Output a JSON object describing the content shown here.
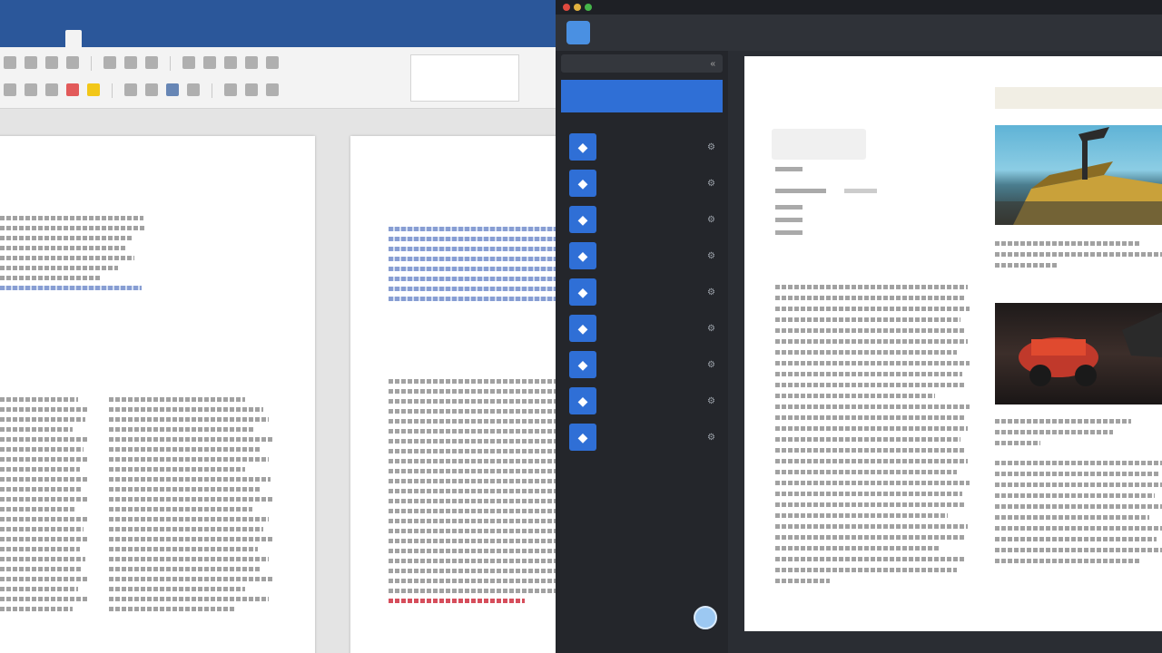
{
  "word": {
    "title_text": "",
    "tabs": [
      "",
      "",
      "",
      "",
      "",
      "",
      "",
      "",
      "",
      "",
      "",
      ""
    ],
    "active_tab_index": 4,
    "doc": {
      "page1_heading": "",
      "page2_heading1": "",
      "page2_heading2": ""
    }
  },
  "reader_app": {
    "logo_text": "",
    "nav": [
      "",
      "",
      "",
      "",
      "",
      "",
      ""
    ],
    "sidebar": {
      "search_placeholder": "",
      "selected_item": "",
      "section_label": "",
      "section_count": "",
      "items": [
        {
          "label": "",
          "icon": "document-icon"
        },
        {
          "label": "",
          "icon": "document-icon"
        },
        {
          "label": "",
          "icon": "document-icon"
        },
        {
          "label": "",
          "icon": "document-icon"
        },
        {
          "label": "",
          "icon": "document-icon"
        },
        {
          "label": "",
          "icon": "document-icon"
        },
        {
          "label": "",
          "icon": "document-icon"
        },
        {
          "label": "",
          "icon": "document-icon"
        },
        {
          "label": "",
          "icon": "document-icon"
        }
      ]
    },
    "article": {
      "title": "",
      "card_text": "",
      "section_heading": "",
      "aside_heading": ""
    },
    "colors": {
      "word_brand": "#2b579a",
      "accent_blue": "#2f6fd6",
      "app_dark": "#2a2d33"
    }
  }
}
